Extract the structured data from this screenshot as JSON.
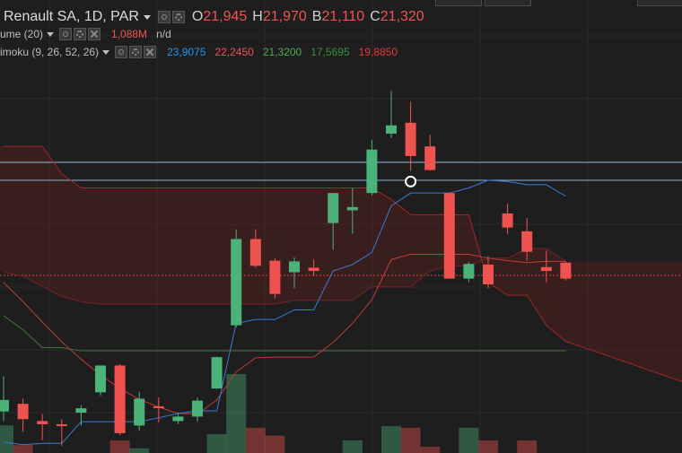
{
  "header": {
    "symbol": "Renault SA, 1D, PAR",
    "ohlc": [
      {
        "label": "O",
        "value": "21,945"
      },
      {
        "label": "H",
        "value": "21,970"
      },
      {
        "label": "B",
        "value": "21,110"
      },
      {
        "label": "C",
        "value": "21,320"
      }
    ]
  },
  "volume_row": {
    "label": "ume (20)",
    "value": "1,088M",
    "na": "n/d"
  },
  "ichimoku_row": {
    "label": "imoku (9, 26, 52, 26)",
    "values": [
      {
        "value": "23,9075",
        "color": "#2196f3"
      },
      {
        "value": "22,2450",
        "color": "#ef5350"
      },
      {
        "value": "21,3200",
        "color": "#4caf50"
      },
      {
        "value": "17,5695",
        "color": "#388e3c"
      },
      {
        "value": "19,8850",
        "color": "#e53935"
      }
    ]
  },
  "colors": {
    "up": "#4bb27a",
    "down": "#ef5350",
    "background": "#1e1e1e"
  },
  "chart_data": {
    "type": "candlestick",
    "candles": [
      {
        "o": 19.2,
        "h": 19.75,
        "l": 19.05,
        "c": 19.38
      },
      {
        "o": 19.32,
        "h": 19.4,
        "l": 18.88,
        "c": 19.08
      },
      {
        "o": 19.05,
        "h": 19.16,
        "l": 18.75,
        "c": 19.0
      },
      {
        "o": 19.0,
        "h": 19.08,
        "l": 18.66,
        "c": 18.98
      },
      {
        "o": 19.18,
        "h": 19.3,
        "l": 18.98,
        "c": 19.25
      },
      {
        "o": 19.5,
        "h": 19.92,
        "l": 19.45,
        "c": 19.92
      },
      {
        "o": 19.92,
        "h": 19.94,
        "l": 18.83,
        "c": 18.86
      },
      {
        "o": 18.98,
        "h": 19.51,
        "l": 18.9,
        "c": 19.4
      },
      {
        "o": 19.28,
        "h": 19.42,
        "l": 19.03,
        "c": 19.26
      },
      {
        "o": 19.05,
        "h": 19.18,
        "l": 19.0,
        "c": 19.12
      },
      {
        "o": 19.12,
        "h": 19.42,
        "l": 19.04,
        "c": 19.37
      },
      {
        "o": 19.56,
        "h": 20.06,
        "l": 19.55,
        "c": 20.05
      },
      {
        "o": 20.55,
        "h": 22.05,
        "l": 20.52,
        "c": 21.9
      },
      {
        "o": 21.9,
        "h": 22.05,
        "l": 21.45,
        "c": 21.48
      },
      {
        "o": 21.56,
        "h": 21.6,
        "l": 20.97,
        "c": 21.04
      },
      {
        "o": 21.38,
        "h": 21.61,
        "l": 21.13,
        "c": 21.55
      },
      {
        "o": 21.45,
        "h": 21.58,
        "l": 21.32,
        "c": 21.4
      },
      {
        "o": 22.15,
        "h": 22.23,
        "l": 21.73,
        "c": 22.62
      },
      {
        "o": 22.35,
        "h": 22.7,
        "l": 21.98,
        "c": 22.4
      },
      {
        "o": 22.62,
        "h": 23.45,
        "l": 22.58,
        "c": 23.3
      },
      {
        "o": 23.55,
        "h": 24.22,
        "l": 23.48,
        "c": 23.68
      },
      {
        "o": 23.72,
        "h": 24.05,
        "l": 22.97,
        "c": 23.2
      },
      {
        "o": 23.35,
        "h": 23.53,
        "l": 22.97,
        "c": 22.98
      },
      {
        "o": 22.62,
        "h": 22.62,
        "l": 21.28,
        "c": 21.28
      },
      {
        "o": 21.28,
        "h": 21.54,
        "l": 21.22,
        "c": 21.51
      },
      {
        "o": 21.5,
        "h": 21.63,
        "l": 21.13,
        "c": 21.19
      },
      {
        "o": 22.3,
        "h": 22.45,
        "l": 21.98,
        "c": 22.08
      },
      {
        "o": 22.02,
        "h": 22.23,
        "l": 21.56,
        "c": 21.7
      },
      {
        "o": 21.46,
        "h": 21.72,
        "l": 21.22,
        "c": 21.4
      },
      {
        "o": 21.53,
        "h": 21.55,
        "l": 21.25,
        "c": 21.28
      }
    ],
    "volume": [
      0.35,
      0.1,
      0.0,
      0.0,
      0.0,
      0.0,
      0.16,
      0.06,
      0.0,
      0.0,
      0.0,
      0.24,
      1.0,
      0.32,
      0.22,
      0.0,
      0.0,
      0.0,
      0.16,
      0.0,
      0.34,
      0.32,
      0.08,
      0.0,
      0.32,
      0.16,
      0.0,
      0.16,
      0.0,
      0.0
    ],
    "ichimoku_lines": {
      "conversion": [
        18.72,
        18.68,
        18.7,
        18.7,
        19.04,
        19.04,
        19.04,
        19.04,
        19.1,
        19.17,
        19.21,
        19.21,
        20.58,
        20.64,
        20.64,
        20.79,
        20.79,
        21.4,
        21.5,
        21.69,
        22.42,
        22.62,
        22.62,
        22.62,
        22.7,
        22.82,
        22.8,
        22.75,
        22.75,
        22.57
      ],
      "base": [
        21.22,
        20.92,
        20.6,
        20.29,
        20.02,
        19.77,
        19.56,
        19.39,
        19.27,
        19.17,
        19.16,
        19.38,
        19.82,
        20.04,
        20.05,
        20.05,
        20.05,
        20.28,
        20.58,
        20.95,
        21.58,
        21.66,
        21.66,
        21.66,
        21.66,
        21.6,
        21.56,
        21.53,
        21.55,
        21.55
      ],
      "span_a": [
        23.35,
        23.35,
        23.35,
        22.92,
        22.7,
        22.7,
        22.7,
        22.7,
        22.7,
        22.7,
        22.7,
        22.7,
        22.7,
        22.7,
        22.7,
        22.7,
        22.7,
        22.7,
        22.7,
        22.7,
        22.52,
        22.28,
        22.28,
        22.28,
        22.28,
        21.22,
        21.02,
        21.02,
        20.55,
        20.3
      ],
      "span_b": [
        21.38,
        21.32,
        21.16,
        21.0,
        20.92,
        20.88,
        20.88,
        20.88,
        20.88,
        20.88,
        20.88,
        20.88,
        20.88,
        20.88,
        20.88,
        20.94,
        20.94,
        20.94,
        20.94,
        21.15,
        21.15,
        21.15,
        21.4,
        21.48,
        21.48,
        21.6,
        21.6,
        21.75,
        21.75,
        21.55
      ],
      "lagging": [
        20.7,
        20.48,
        20.2,
        20.2,
        20.15,
        20.15,
        20.15,
        20.15,
        20.15,
        20.15,
        20.15,
        20.15,
        20.15,
        20.15,
        20.15,
        20.15,
        20.15,
        20.15,
        20.15,
        20.15,
        20.15,
        20.15,
        20.15,
        20.15,
        20.15,
        20.15,
        20.15,
        20.15,
        20.15,
        20.15
      ]
    },
    "price_lines": [
      22.82,
      23.1,
      21.33
    ],
    "crosshair": {
      "index": 21,
      "price": 22.8
    },
    "ylim": [
      18.62,
      24.35
    ]
  }
}
